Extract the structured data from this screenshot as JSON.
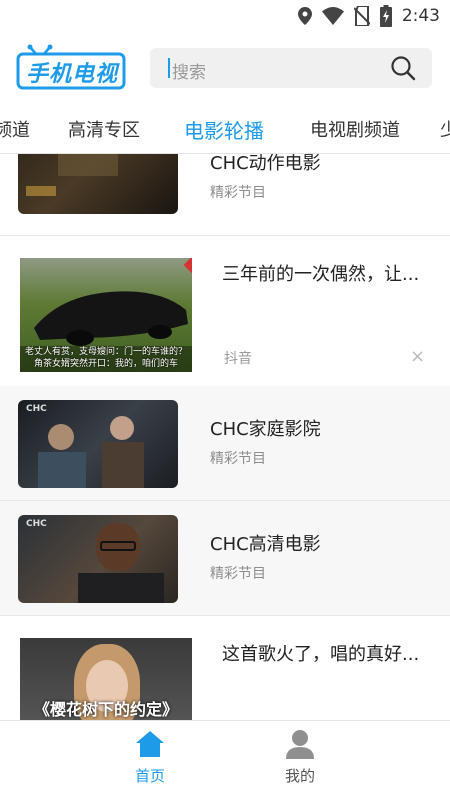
{
  "status": {
    "time": "2:43"
  },
  "header": {
    "logo_text": "手机电视",
    "search_placeholder": "搜索"
  },
  "tabs": [
    {
      "label": "频道"
    },
    {
      "label": "高清专区"
    },
    {
      "label": "电影轮播"
    },
    {
      "label": "电视剧频道"
    },
    {
      "label": "少"
    }
  ],
  "active_tab": "电影轮播",
  "feed": [
    {
      "title": "CHC动作电影",
      "subtitle": "精彩节目"
    },
    {
      "title": "三年前的一次偶然，让...",
      "source": "抖音",
      "overlay_text": "老丈人有赏，支母嫂问：门一的车谁的？\n角茶女婿突然开口：我的，咱们的车"
    },
    {
      "title": "CHC家庭影院",
      "subtitle": "精彩节目",
      "channel_logo": "CHC"
    },
    {
      "title": "CHC高清电影",
      "subtitle": "精彩节目",
      "channel_logo": "CHC"
    },
    {
      "title": "这首歌火了，唱的真好...",
      "overlay_text": "《樱花树下的约定》"
    }
  ],
  "bottom_nav": [
    {
      "label": "首页",
      "active": true
    },
    {
      "label": "我的",
      "active": false
    }
  ],
  "colors": {
    "accent": "#1e9be8",
    "text": "#222222",
    "muted": "#8c8c8c"
  }
}
